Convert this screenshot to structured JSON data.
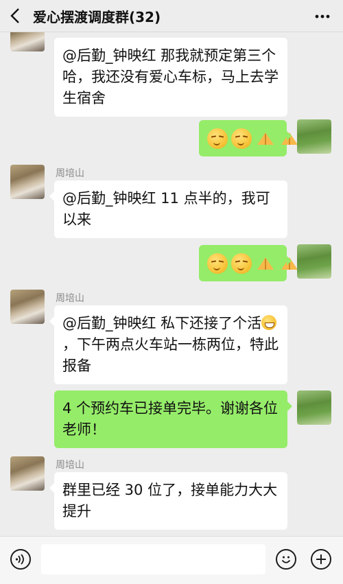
{
  "header": {
    "title": "爱心摆渡调度群(32)"
  },
  "messages": [
    {
      "side": "other",
      "text": "@后勤_钟映红  那我就预定第三个哈，我还没有爱心车标，马上去学生宿舍"
    },
    {
      "side": "me",
      "emojis": [
        "smirk-emoji",
        "smirk-emoji",
        "pray-hands-emoji",
        "pray-hands-emoji"
      ]
    },
    {
      "side": "other",
      "sender": "周培山",
      "text": "@后勤_钟映红  11 点半的，我可以来"
    },
    {
      "side": "me",
      "emojis": [
        "smirk-emoji",
        "smirk-emoji",
        "pray-hands-emoji",
        "pray-hands-emoji"
      ]
    },
    {
      "side": "other",
      "sender": "周培山",
      "text_before": "@后勤_钟映红  私下还接了个活",
      "inline_emoji": "grin-emoji",
      "text_after": "，下午两点火车站一栋两位，特此报备"
    },
    {
      "side": "me",
      "text": "4 个预约车已接单完毕。谢谢各位老师！"
    },
    {
      "side": "other",
      "sender": "周培山",
      "text": "群里已经 30 位了，接单能力大大提升"
    }
  ],
  "input": {
    "value": ""
  },
  "icons": {
    "back": "chevron-left-icon",
    "more": "more-dots-icon",
    "voice": "voice-icon",
    "emoji": "emoji-icon",
    "add": "add-icon"
  }
}
